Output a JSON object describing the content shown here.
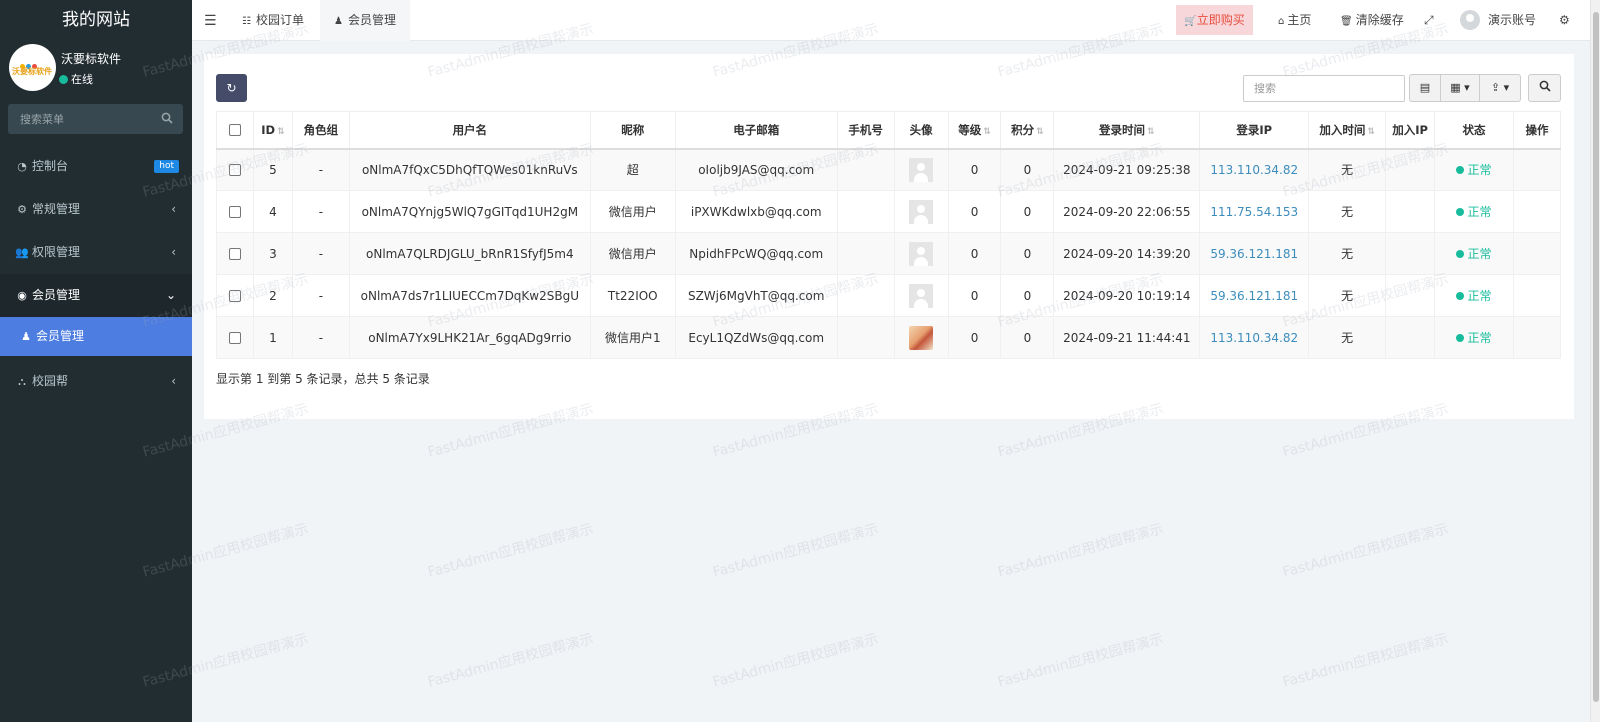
{
  "sidebar": {
    "brand": "我的网站",
    "user_name": "沃要标软件",
    "status": "在线",
    "avatar_text": "沃要标软件",
    "search_placeholder": "搜索菜单",
    "items": [
      {
        "label": "控制台",
        "icon": "dashboard-icon",
        "badge": "hot"
      },
      {
        "label": "常规管理",
        "icon": "cogs-icon"
      },
      {
        "label": "权限管理",
        "icon": "group-icon"
      },
      {
        "label": "会员管理",
        "icon": "user-circle-icon"
      },
      {
        "label": "会员管理",
        "icon": "user-icon"
      },
      {
        "label": "校园帮",
        "icon": "sitemap-icon"
      }
    ]
  },
  "topbar": {
    "tabs": [
      {
        "label": "校园订单",
        "icon": "list-icon"
      },
      {
        "label": "会员管理",
        "icon": "user-icon"
      }
    ],
    "buy": "立即购买",
    "home": "主页",
    "clear_cache": "清除缓存",
    "account": "演示账号"
  },
  "toolbar": {
    "search_placeholder": "搜索"
  },
  "table": {
    "headers": [
      "ID",
      "角色组",
      "用户名",
      "昵称",
      "电子邮箱",
      "手机号",
      "头像",
      "等级",
      "积分",
      "登录时间",
      "登录IP",
      "加入时间",
      "加入IP",
      "状态",
      "操作"
    ],
    "rows": [
      {
        "id": "5",
        "group": "-",
        "username": "oNlmA7fQxC5DhQfTQWes01knRuVs",
        "nickname": "超",
        "email": "oIoljb9JAS@qq.com",
        "mobile": "",
        "avatar": "placeholder",
        "level": "0",
        "score": "0",
        "logintime": "2024-09-21 09:25:38",
        "loginip": "113.110.34.82",
        "jointime": "无",
        "joinip": "",
        "status": "正常"
      },
      {
        "id": "4",
        "group": "-",
        "username": "oNlmA7QYnjg5WlQ7gGITqd1UH2gM",
        "nickname": "微信用户",
        "email": "iPXWKdwlxb@qq.com",
        "mobile": "",
        "avatar": "placeholder",
        "level": "0",
        "score": "0",
        "logintime": "2024-09-20 22:06:55",
        "loginip": "111.75.54.153",
        "jointime": "无",
        "joinip": "",
        "status": "正常"
      },
      {
        "id": "3",
        "group": "-",
        "username": "oNlmA7QLRDJGLU_bRnR1SfyfJ5m4",
        "nickname": "微信用户",
        "email": "NpidhFPcWQ@qq.com",
        "mobile": "",
        "avatar": "placeholder",
        "level": "0",
        "score": "0",
        "logintime": "2024-09-20 14:39:20",
        "loginip": "59.36.121.181",
        "jointime": "无",
        "joinip": "",
        "status": "正常"
      },
      {
        "id": "2",
        "group": "-",
        "username": "oNlmA7ds7r1LIUECCm7DqKw2SBgU",
        "nickname": "Tt22IOO",
        "email": "SZWj6MgVhT@qq.com",
        "mobile": "",
        "avatar": "placeholder",
        "level": "0",
        "score": "0",
        "logintime": "2024-09-20 10:19:14",
        "loginip": "59.36.121.181",
        "jointime": "无",
        "joinip": "",
        "status": "正常"
      },
      {
        "id": "1",
        "group": "-",
        "username": "oNlmA7Yx9LHK21Ar_6gqADg9rrio",
        "nickname": "微信用户1",
        "email": "EcyL1QZdWs@qq.com",
        "mobile": "",
        "avatar": "image",
        "level": "0",
        "score": "0",
        "logintime": "2024-09-21 11:44:41",
        "loginip": "113.110.34.82",
        "jointime": "无",
        "joinip": "",
        "status": "正常"
      }
    ]
  },
  "pager": {
    "info": "显示第 1 到第 5 条记录，总共 5 条记录"
  },
  "watermark": "FastAdmin应用校园帮演示",
  "colors": {
    "sidebar_bg": "#222d32",
    "active_menu": "#4d7de0",
    "status_green": "#18bc9c",
    "ip_blue": "#3c8dbc",
    "buy_red": "#e74c3c"
  }
}
